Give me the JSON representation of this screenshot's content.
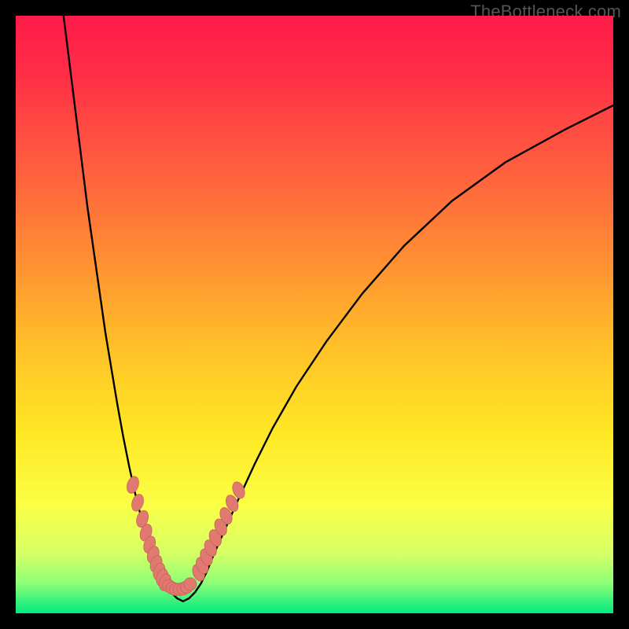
{
  "watermark": "TheBottleneck.com",
  "colors": {
    "black": "#000000",
    "curve": "#000000",
    "marker_fill": "#e0796f",
    "marker_stroke": "#c9625a",
    "gradient_stops": [
      {
        "offset": 0.0,
        "color": "#ff1a4a"
      },
      {
        "offset": 0.1,
        "color": "#ff2f46"
      },
      {
        "offset": 0.25,
        "color": "#ff5d3f"
      },
      {
        "offset": 0.4,
        "color": "#ff8c33"
      },
      {
        "offset": 0.55,
        "color": "#ffbf28"
      },
      {
        "offset": 0.7,
        "color": "#ffe824"
      },
      {
        "offset": 0.82,
        "color": "#faff46"
      },
      {
        "offset": 0.9,
        "color": "#d6ff66"
      },
      {
        "offset": 0.95,
        "color": "#8cff77"
      },
      {
        "offset": 1.0,
        "color": "#00e880"
      }
    ]
  },
  "chart_data": {
    "type": "line",
    "title": "",
    "xlabel": "",
    "ylabel": "",
    "xlim": [
      0,
      100
    ],
    "ylim": [
      0,
      100
    ],
    "curve": {
      "description": "Bottleneck percentage vs component balance; V-shaped curve with minimum near x≈25",
      "x": [
        8,
        9,
        10,
        11,
        12,
        13,
        14,
        15,
        16,
        17,
        18,
        19,
        20,
        21,
        22,
        23,
        24,
        25,
        26,
        27,
        28,
        29,
        30,
        31,
        32,
        33,
        35,
        37,
        40,
        43,
        47,
        52,
        58,
        65,
        73,
        82,
        92,
        100
      ],
      "y": [
        100,
        92,
        84,
        76,
        68,
        61,
        54,
        47,
        41,
        35,
        29.5,
        24.5,
        20,
        16,
        12.5,
        9.5,
        7,
        5,
        3.5,
        2.5,
        2,
        2.5,
        3.5,
        5,
        7,
        9.5,
        14,
        18.5,
        25,
        31,
        38,
        45.5,
        53.5,
        61.5,
        69,
        75.5,
        81,
        85
      ]
    },
    "series": [
      {
        "name": "markers-left",
        "x": [
          19.6,
          20.4,
          21.2,
          21.8,
          22.4,
          23.0,
          23.5,
          24.0,
          24.5,
          25.0
        ],
        "y": [
          21.5,
          18.5,
          15.8,
          13.5,
          11.5,
          9.8,
          8.3,
          7.0,
          6.0,
          5.2
        ]
      },
      {
        "name": "markers-bottom",
        "x": [
          25.6,
          26.2,
          26.8,
          27.4,
          28.0,
          28.6,
          29.2
        ],
        "y": [
          4.6,
          4.2,
          4.0,
          4.0,
          4.1,
          4.4,
          4.9
        ]
      },
      {
        "name": "markers-right",
        "x": [
          30.6,
          31.2,
          31.9,
          32.6,
          33.4,
          34.3,
          35.2,
          36.2,
          37.3
        ],
        "y": [
          6.8,
          8.0,
          9.4,
          10.9,
          12.6,
          14.4,
          16.3,
          18.4,
          20.6
        ]
      }
    ]
  }
}
